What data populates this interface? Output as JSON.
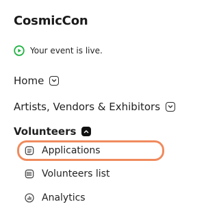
{
  "app": {
    "title": "CosmicCon"
  },
  "status": {
    "text": "Your event is live.",
    "color": "#1fb141",
    "icon": "play-circle-icon"
  },
  "nav": {
    "home": {
      "label": "Home",
      "icon": "chevron-down-icon"
    },
    "artists": {
      "label": "Artists, Vendors & Exhibitors",
      "icon": "chevron-down-icon"
    },
    "volunteers": {
      "label": "Volunteers",
      "icon": "chevron-up-icon"
    }
  },
  "subnav": [
    {
      "label": "Applications",
      "icon": "document-icon",
      "selected": true
    },
    {
      "label": "Volunteers list",
      "icon": "list-icon",
      "selected": false
    },
    {
      "label": "Analytics",
      "icon": "analytics-icon",
      "selected": false
    }
  ],
  "colors": {
    "highlight": "#f08a5d",
    "text": "#1f1f1f"
  }
}
